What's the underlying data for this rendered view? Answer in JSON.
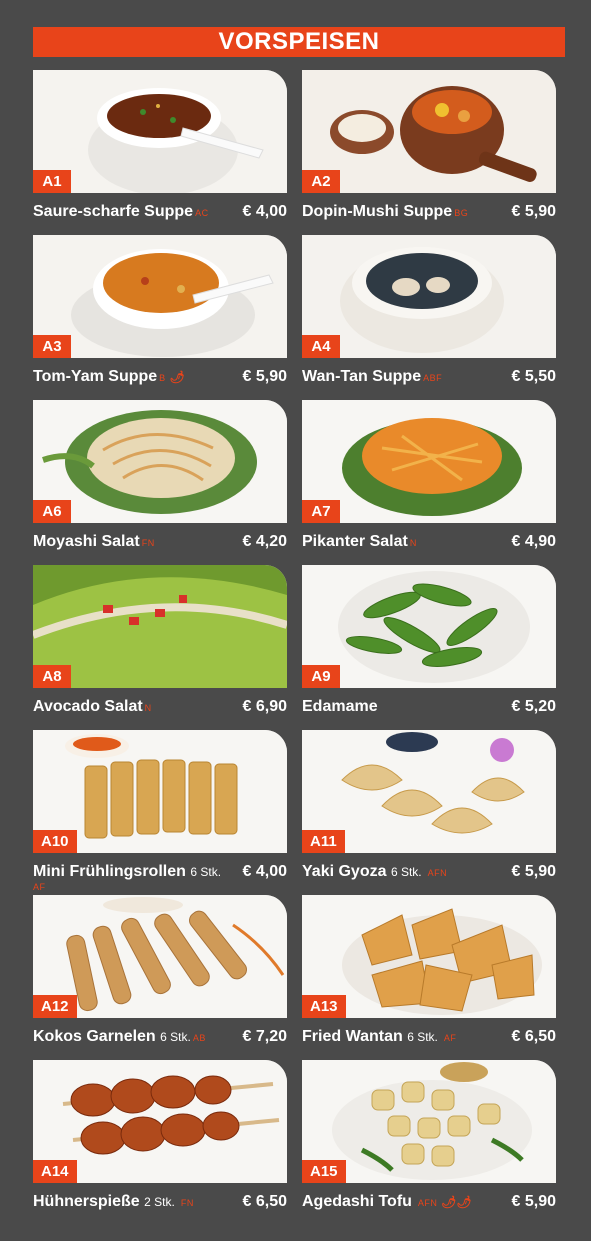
{
  "header": {
    "title": "VORSPEISEN"
  },
  "items": [
    {
      "code": "A1",
      "name": "Saure-scharfe Suppe",
      "qty": "",
      "allergen": "AC",
      "chili": "",
      "price": "€ 4,00",
      "photo": "hot-sour-soup-photo"
    },
    {
      "code": "A2",
      "name": "Dopin-Mushi Suppe",
      "qty": "",
      "allergen": "BG",
      "chili": "",
      "price": "€ 5,90",
      "photo": "dobin-mushi-soup-photo"
    },
    {
      "code": "A3",
      "name": "Tom-Yam Suppe",
      "qty": "",
      "allergen": "B",
      "chili": "🌶",
      "price": "€ 5,90",
      "photo": "tom-yam-soup-photo"
    },
    {
      "code": "A4",
      "name": "Wan-Tan Suppe",
      "qty": "",
      "allergen": "ABF",
      "chili": "",
      "price": "€ 5,50",
      "photo": "wan-tan-soup-photo"
    },
    {
      "code": "A6",
      "name": "Moyashi Salat",
      "qty": "",
      "allergen": "FN",
      "chili": "",
      "price": "€ 4,20",
      "photo": "moyashi-salad-photo"
    },
    {
      "code": "A7",
      "name": "Pikanter Salat",
      "qty": "",
      "allergen": "N",
      "chili": "",
      "price": "€ 4,90",
      "photo": "spicy-salad-photo"
    },
    {
      "code": "A8",
      "name": "Avocado Salat",
      "qty": "",
      "allergen": "N",
      "chili": "",
      "price": "€ 6,90",
      "photo": "avocado-salad-photo"
    },
    {
      "code": "A9",
      "name": "Edamame",
      "qty": "",
      "allergen": "",
      "chili": "",
      "price": "€ 5,20",
      "photo": "edamame-photo"
    },
    {
      "code": "A10",
      "name": "Mini Frühlingsrollen",
      "qty": "6 Stk.",
      "allergen": "",
      "chili": "",
      "price": "€ 4,00",
      "extra_allergen": "AF",
      "photo": "spring-rolls-photo"
    },
    {
      "code": "A11",
      "name": "Yaki Gyoza",
      "qty": "6 Stk.",
      "allergen": "AFN",
      "chili": "",
      "price": "€ 5,90",
      "photo": "gyoza-photo"
    },
    {
      "code": "A12",
      "name": "Kokos Garnelen",
      "qty": "6 Stk.",
      "allergen": "AB",
      "chili": "",
      "price": "€ 7,20",
      "photo": "coconut-shrimp-photo"
    },
    {
      "code": "A13",
      "name": "Fried Wantan",
      "qty": "6 Stk.",
      "allergen": "AF",
      "chili": "",
      "price": "€ 6,50",
      "photo": "fried-wantan-photo"
    },
    {
      "code": "A14",
      "name": "Hühnerspieße",
      "qty": "2 Stk.",
      "allergen": "FN",
      "chili": "",
      "price": "€ 6,50",
      "photo": "chicken-skewers-photo"
    },
    {
      "code": "A15",
      "name": "Agedashi Tofu",
      "qty": "",
      "allergen": "AFN",
      "chili": "🌶🌶",
      "price": "€ 5,90",
      "photo": "agedashi-tofu-photo"
    }
  ],
  "colors": {
    "accent": "#e8441a",
    "background": "#4a4a4a",
    "text": "#ffffff"
  }
}
